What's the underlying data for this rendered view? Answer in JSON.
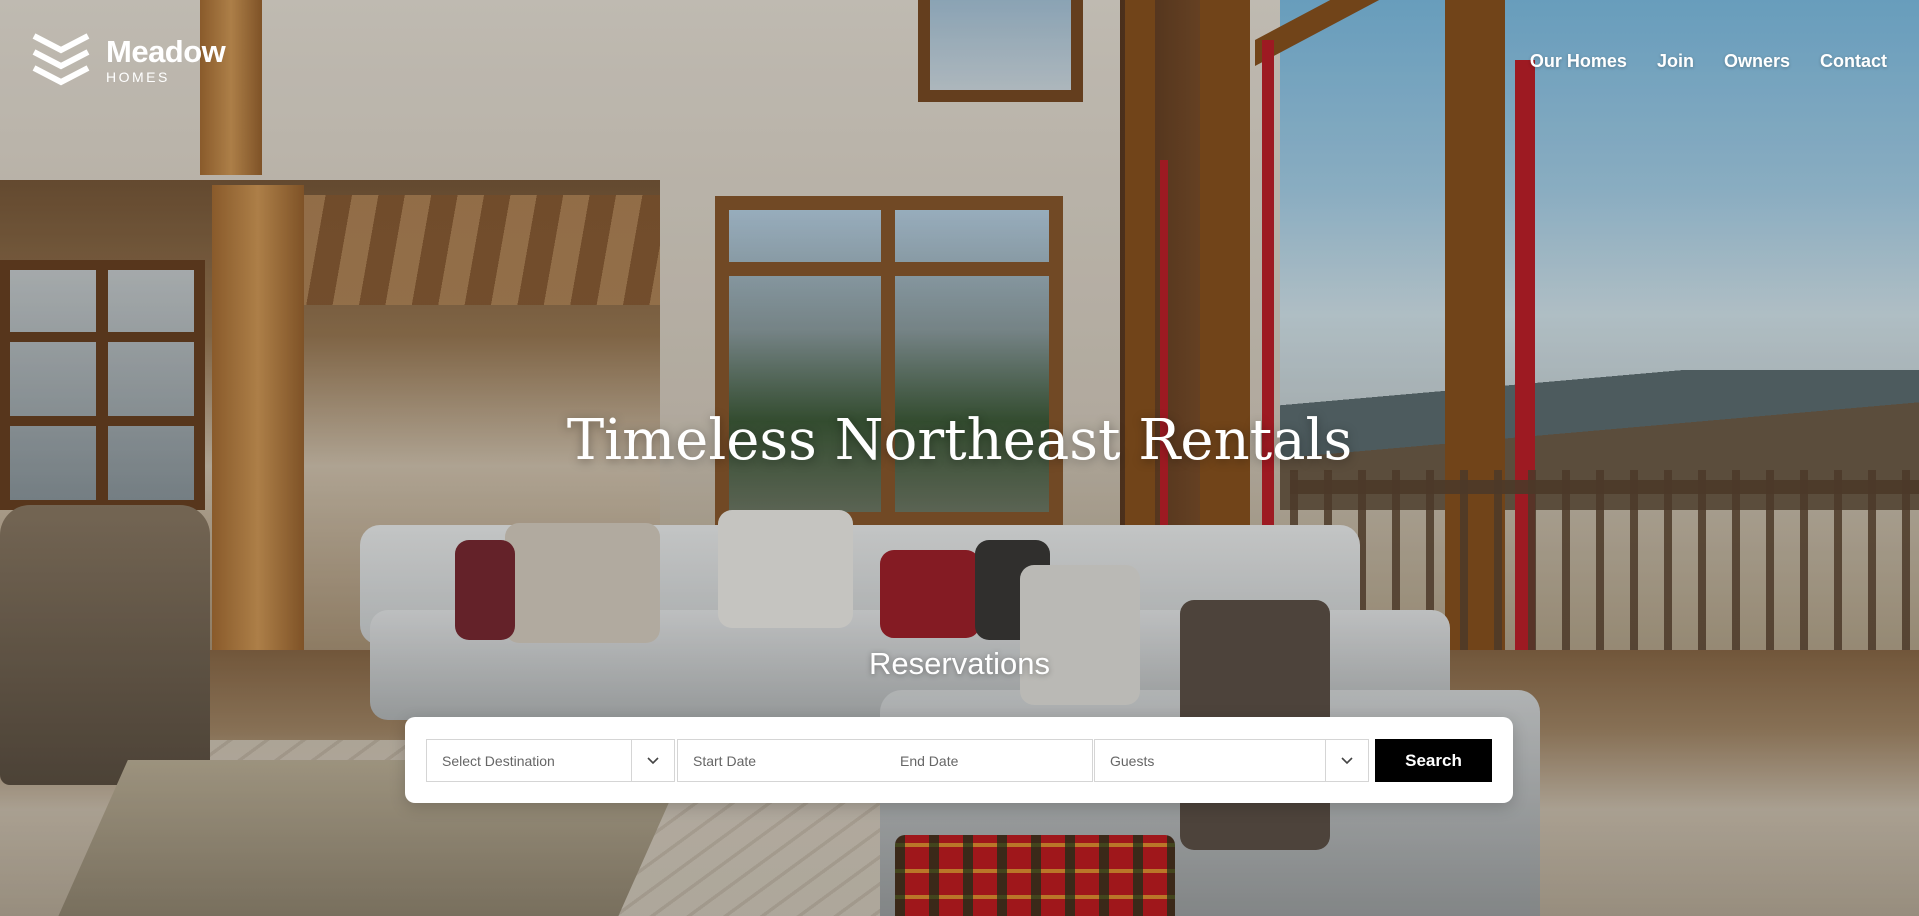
{
  "brand": {
    "name": "Meadow",
    "sub": "HOMES",
    "logo_icon": "chevrons-logo-icon"
  },
  "nav": {
    "items": [
      "Our Homes",
      "Join",
      "Owners",
      "Contact"
    ]
  },
  "hero": {
    "headline": "Timeless Northeast Rentals",
    "section_label": "Reservations"
  },
  "reservation": {
    "destination_placeholder": "Select Destination",
    "start_date_placeholder": "Start Date",
    "end_date_placeholder": "End Date",
    "guests_placeholder": "Guests",
    "search_label": "Search",
    "dropdown_icon": "chevron-down-icon"
  },
  "colors": {
    "search_button_bg": "#000000",
    "text_on_hero": "#ffffff",
    "panel_bg": "#ffffff"
  }
}
